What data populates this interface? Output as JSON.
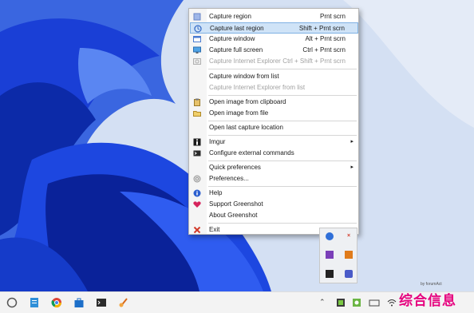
{
  "menu": {
    "items": [
      {
        "label": "Capture region",
        "shortcut": "Prnt scrn",
        "icon": "capture-region-icon"
      },
      {
        "label": "Capture last region",
        "shortcut": "Shift + Prnt scrn",
        "icon": "capture-last-region-icon",
        "highlighted": true
      },
      {
        "label": "Capture window",
        "shortcut": "Alt + Prnt scrn",
        "icon": "capture-window-icon"
      },
      {
        "label": "Capture full screen",
        "shortcut": "Ctrl + Prnt scrn",
        "icon": "capture-full-screen-icon"
      },
      {
        "label": "Capture Internet Explorer",
        "shortcut": "Ctrl + Shift + Prnt scrn",
        "icon": "capture-ie-icon",
        "disabled": true
      },
      {
        "label": "Capture window from list"
      },
      {
        "label": "Capture Internet Explorer from list",
        "disabled": true
      },
      {
        "label": "Open image from clipboard",
        "icon": "clipboard-icon"
      },
      {
        "label": "Open image from file",
        "icon": "open-file-icon"
      },
      {
        "label": "Open last capture location"
      },
      {
        "label": "Imgur",
        "icon": "imgur-icon",
        "submenu": true
      },
      {
        "label": "Configure external commands",
        "icon": "external-commands-icon"
      },
      {
        "label": "Quick preferences",
        "submenu": true
      },
      {
        "label": "Preferences...",
        "icon": "preferences-icon"
      },
      {
        "label": "Help",
        "icon": "help-icon"
      },
      {
        "label": "Support Greenshot",
        "icon": "heart-icon"
      },
      {
        "label": "About Greenshot"
      },
      {
        "label": "Exit",
        "icon": "exit-icon"
      }
    ],
    "submenu_arrow": "▸"
  },
  "watermark": {
    "text": "综合信息",
    "sub": "by forumAct"
  },
  "colors": {
    "highlight": "#cfe3f7",
    "highlight_border": "#7fb1e3",
    "wallpaper_bg": "#cfdcf0",
    "wallpaper_blue": "#1a3fd6"
  }
}
